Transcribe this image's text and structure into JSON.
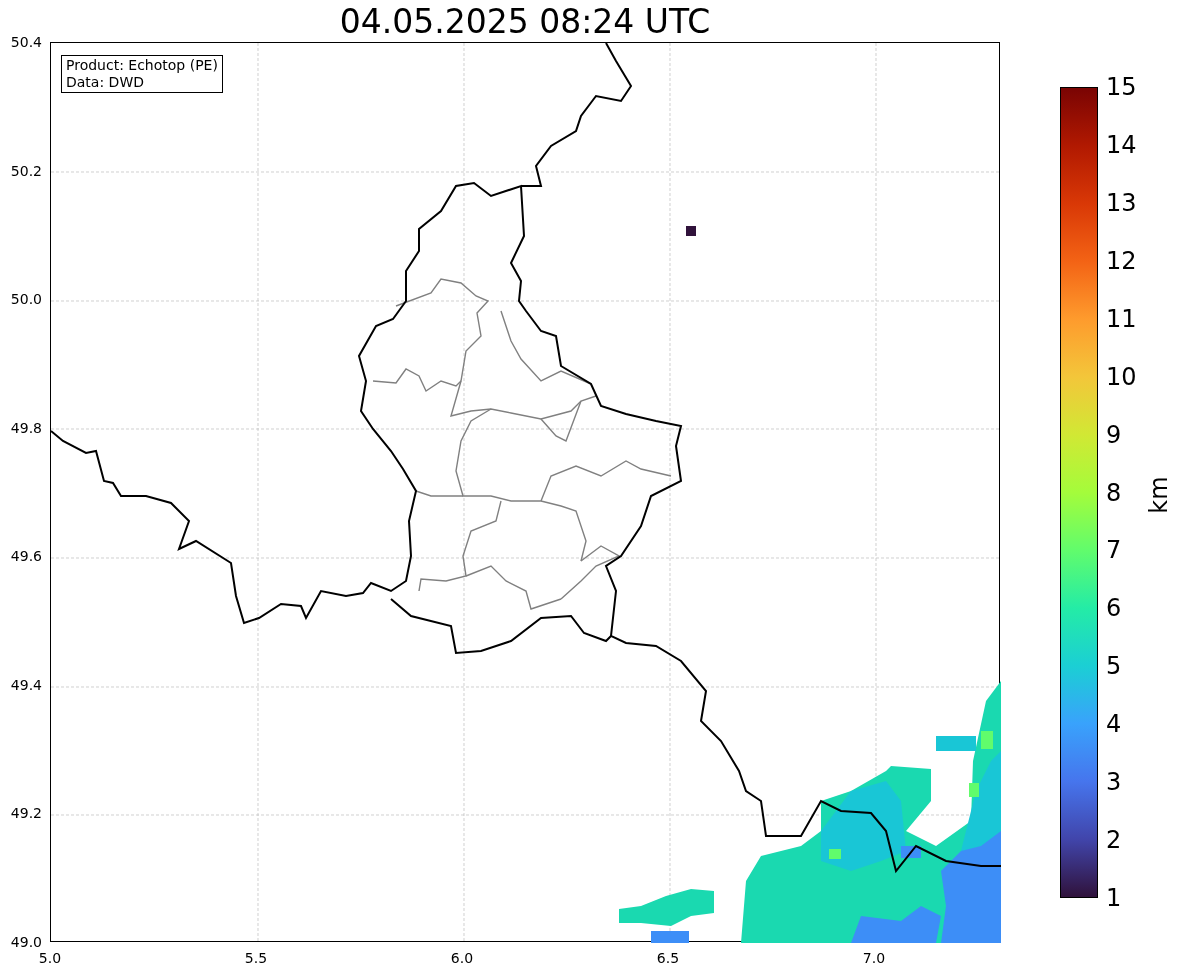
{
  "title": "04.05.2025 08:24 UTC",
  "legend": [
    "Product: Echotop (PE)",
    "Data: DWD"
  ],
  "map": {
    "yticks": [
      "50.4",
      "50.2",
      "50.0",
      "49.8",
      "49.6",
      "49.4",
      "49.2",
      "49.0"
    ],
    "xticks": [
      "5.0",
      "5.5",
      "6.0",
      "6.5",
      "7.0"
    ]
  },
  "colorbar": {
    "label": "km",
    "ticks": [
      "15",
      "14",
      "13",
      "12",
      "11",
      "10",
      "9",
      "8",
      "7",
      "6",
      "5",
      "4",
      "3",
      "2",
      "1"
    ]
  }
}
